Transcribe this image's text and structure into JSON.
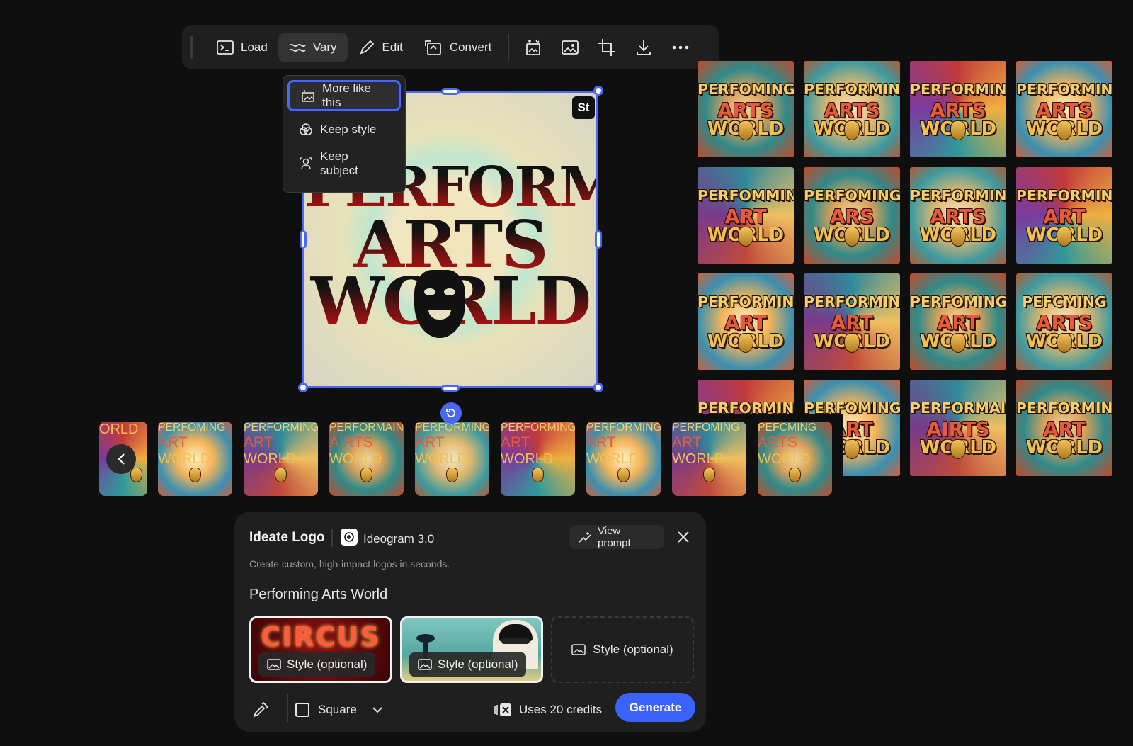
{
  "toolbar": {
    "load_label": "Load",
    "vary_label": "Vary",
    "edit_label": "Edit",
    "convert_label": "Convert",
    "icons": [
      "generate-variations-icon",
      "image-icon",
      "crop-icon",
      "download-icon",
      "more-icon"
    ]
  },
  "vary_menu": {
    "items": [
      {
        "label": "More like this",
        "icon": "sparkle-image-icon",
        "selected": true
      },
      {
        "label": "Keep style",
        "icon": "style-circles-icon",
        "selected": false
      },
      {
        "label": "Keep subject",
        "icon": "subject-icon",
        "selected": false
      }
    ]
  },
  "canvas": {
    "badge": "St",
    "logo_lines": [
      "PERFORMING",
      "ARTS",
      "WORLD"
    ]
  },
  "grid": {
    "tiles": [
      [
        "PERFOMING",
        "ARTS",
        "WORLD"
      ],
      [
        "PERFORMING",
        "ARTS",
        "WORLD"
      ],
      [
        "PERFORMING",
        "ARTS",
        "WORLD"
      ],
      [
        "PERFORMING",
        "ARTS",
        "WORLD"
      ],
      [
        "PERFOMMING",
        "ART",
        "WORLD"
      ],
      [
        "PERFOMING",
        "ARS",
        "WORLD"
      ],
      [
        "PERFORMING",
        "ARTS",
        "WORLD"
      ],
      [
        "PERFORMING",
        "ART",
        "WORLD"
      ],
      [
        "PERFORMING",
        "ART",
        "WORLD"
      ],
      [
        "PERFORMING",
        "ART",
        "WORLD"
      ],
      [
        "PERFOMING",
        "ART",
        "WORLD"
      ],
      [
        "PEFCMING",
        "ARTS",
        "WORLD"
      ],
      [
        "PERFORMING",
        "ART",
        "WORLD"
      ],
      [
        "PERFOMING",
        "ART",
        "WORLD"
      ],
      [
        "PERFORMAING",
        "AIRTS",
        "WORLD"
      ],
      [
        "PERFORMING",
        "ART",
        "WORLD"
      ]
    ]
  },
  "filmstrip": {
    "tiles": [
      [
        "",
        "",
        "ORLD"
      ],
      [
        "PERFOMING",
        "ART",
        "WORLD"
      ],
      [
        "PERFORMING",
        "ART",
        "WORLD"
      ],
      [
        "PERFORMAING",
        "AIRTS",
        "WORLD"
      ],
      [
        "PERFORMING",
        "ART",
        "WORLD"
      ],
      [
        "PERFORMING",
        "ART",
        "WORLD"
      ],
      [
        "PERFORMING",
        "ART",
        "WORLD"
      ],
      [
        "PERFOMING",
        "ART",
        "WORLD"
      ],
      [
        "PEFCMING",
        "ARTS",
        "WORLD"
      ]
    ]
  },
  "panel": {
    "title": "Ideate Logo",
    "model": "Ideogram 3.0",
    "view_prompt": "View prompt",
    "subtitle": "Create custom, high-impact logos in seconds.",
    "prompt": "Performing Arts World",
    "style_label": "Style (optional)",
    "aspect": "Square",
    "credits": "Uses 20 credits",
    "generate": "Generate",
    "circus_text": "CIRCUS"
  },
  "colors": {
    "accent": "#4a68f5",
    "generate": "#3b63fb",
    "background": "#0f0f0f",
    "panel": "#1f1f1f"
  }
}
